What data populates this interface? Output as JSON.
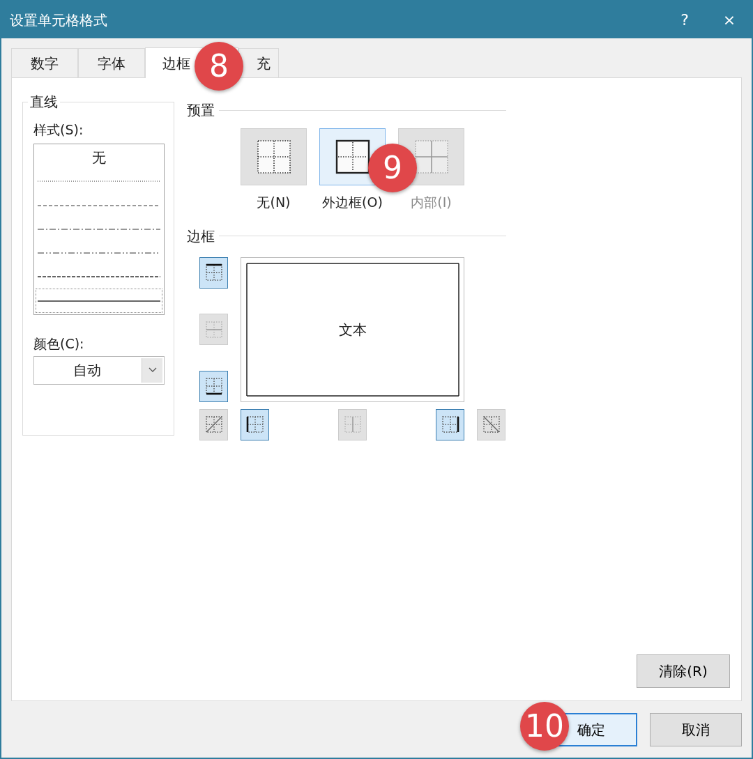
{
  "window": {
    "title": "设置单元格格式",
    "help": "?",
    "close": "×"
  },
  "tabs": [
    {
      "label": "数字",
      "selected": false
    },
    {
      "label": "字体",
      "selected": false
    },
    {
      "label": "边框",
      "selected": true
    },
    {
      "label": "充",
      "selected": false
    }
  ],
  "line_group": {
    "title": "直线",
    "style_label": "样式(S):",
    "styles": [
      {
        "kind": "none",
        "label": "无",
        "selected": false
      },
      {
        "kind": "dotted",
        "selected": false
      },
      {
        "kind": "dashed",
        "selected": false
      },
      {
        "kind": "dash-dot",
        "selected": false
      },
      {
        "kind": "dash-dot-dot",
        "selected": false
      },
      {
        "kind": "dense-dashed",
        "selected": false
      },
      {
        "kind": "solid",
        "selected": true
      }
    ],
    "color_label": "颜色(C):",
    "color_value": "自动"
  },
  "presets": {
    "title": "预置",
    "items": [
      {
        "kind": "none",
        "label": "无(N)",
        "selected": false,
        "disabled": false
      },
      {
        "kind": "outline",
        "label": "外边框(O)",
        "selected": true,
        "disabled": false
      },
      {
        "kind": "inside",
        "label": "内部(I)",
        "selected": false,
        "disabled": true
      }
    ]
  },
  "border": {
    "title": "边框",
    "preview_text": "文本",
    "buttons": [
      {
        "kind": "top",
        "on": true,
        "disabled": false
      },
      {
        "kind": "mid-h",
        "on": false,
        "disabled": true
      },
      {
        "kind": "bottom",
        "on": true,
        "disabled": false
      },
      {
        "kind": "diag-up",
        "on": false,
        "disabled": false
      },
      {
        "kind": "left",
        "on": true,
        "disabled": false
      },
      {
        "kind": "mid-v",
        "on": false,
        "disabled": true
      },
      {
        "kind": "right",
        "on": true,
        "disabled": false
      },
      {
        "kind": "diag-down",
        "on": false,
        "disabled": false
      }
    ]
  },
  "clear_button": "清除(R)",
  "buttons": [
    {
      "label": "确定",
      "default": true
    },
    {
      "label": "取消",
      "default": false
    }
  ],
  "callouts": [
    "8",
    "9",
    "10"
  ]
}
